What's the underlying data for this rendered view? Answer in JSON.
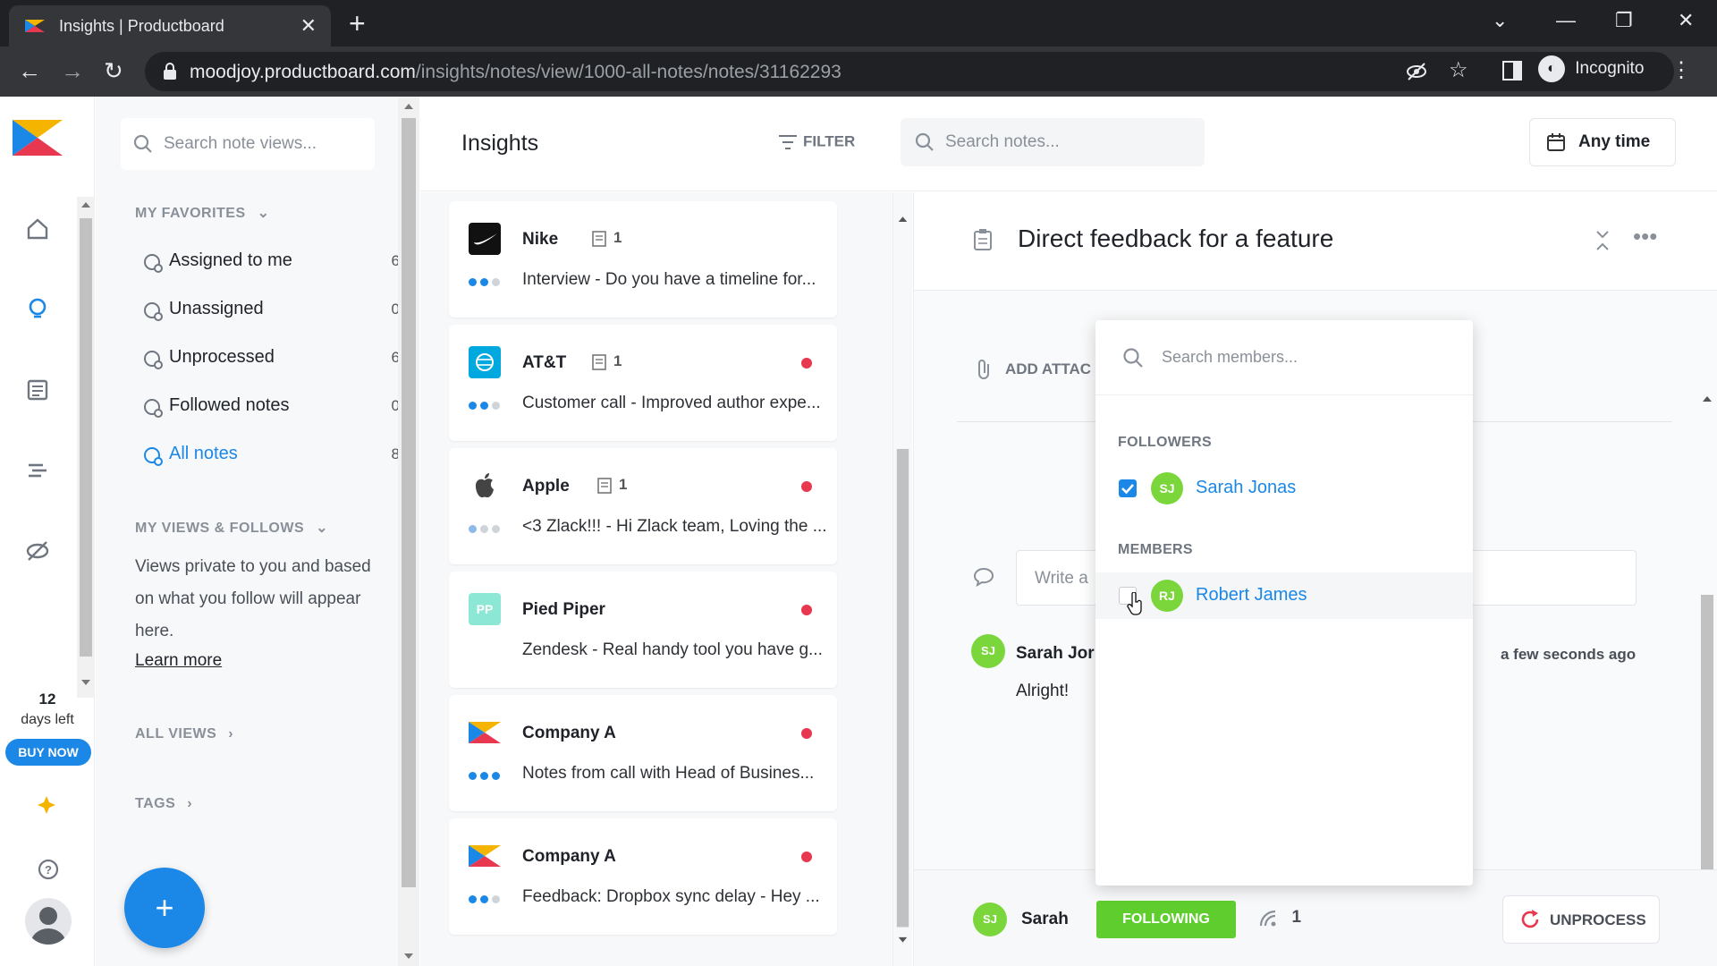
{
  "browser": {
    "tab_title": "Insights | Productboard",
    "url_domain": "moodjoy.productboard.com",
    "url_path": "/insights/notes/view/1000-all-notes/notes/31162293",
    "profile_label": "Incognito"
  },
  "rail": {
    "trial_days": "12",
    "trial_label": "days left",
    "buy_label": "BUY NOW"
  },
  "sidebar": {
    "search_placeholder": "Search note views...",
    "favorites_heading": "MY FAVORITES",
    "favorites": [
      {
        "label": "Assigned to me",
        "count": "6"
      },
      {
        "label": "Unassigned",
        "count": "0"
      },
      {
        "label": "Unprocessed",
        "count": "6"
      },
      {
        "label": "Followed notes",
        "count": "0"
      },
      {
        "label": "All notes",
        "count": "8"
      }
    ],
    "views_heading": "MY VIEWS & FOLLOWS",
    "views_help": "Views private to you and based on what you follow will appear here.",
    "learn_more": "Learn more",
    "all_views": "ALL VIEWS",
    "tags": "TAGS",
    "fab_label": "+"
  },
  "header": {
    "title": "Insights",
    "filter_label": "FILTER",
    "search_placeholder": "Search notes...",
    "date_filter": "Any time"
  },
  "notes": [
    {
      "company": "Nike",
      "doc_count": "1",
      "text": "Interview - Do you have a timeline for...",
      "unread": false
    },
    {
      "company": "AT&T",
      "doc_count": "1",
      "text": "Customer call - Improved author expe...",
      "unread": true
    },
    {
      "company": "Apple",
      "doc_count": "1",
      "text": "<3 Zlack!!! - Hi Zlack team, Loving the ...",
      "unread": true
    },
    {
      "company": "Pied Piper",
      "logo_text": "PP",
      "text": "Zendesk - Real handy tool you have g...",
      "unread": true
    },
    {
      "company": "Company A",
      "text": "Notes from call with Head of Busines...",
      "unread": true
    },
    {
      "company": "Company A",
      "text": "Feedback: Dropbox sync delay - Hey ...",
      "unread": true
    }
  ],
  "detail": {
    "title": "Direct feedback for a feature",
    "add_attachment": "ADD ATTAC",
    "comment_placeholder": "Write a",
    "comment": {
      "avatar": "SJ",
      "author": "Sarah Jor",
      "time": "a few seconds ago",
      "text": "Alright!"
    },
    "footer": {
      "avatar": "SJ",
      "owner": "Sarah",
      "following_label": "FOLLOWING",
      "followers_count": "1",
      "unprocess_label": "UNPROCESS"
    }
  },
  "dropdown": {
    "search_placeholder": "Search members...",
    "followers_heading": "FOLLOWERS",
    "followers": [
      {
        "initials": "SJ",
        "name": "Sarah Jonas",
        "checked": true
      }
    ],
    "members_heading": "MEMBERS",
    "members": [
      {
        "initials": "RJ",
        "name": "Robert James",
        "checked": false
      }
    ]
  },
  "colors": {
    "accent": "#1b87e6",
    "following_green": "#5fcd2e",
    "avatar_green": "#7bd63b",
    "unread_red": "#e8384f"
  }
}
